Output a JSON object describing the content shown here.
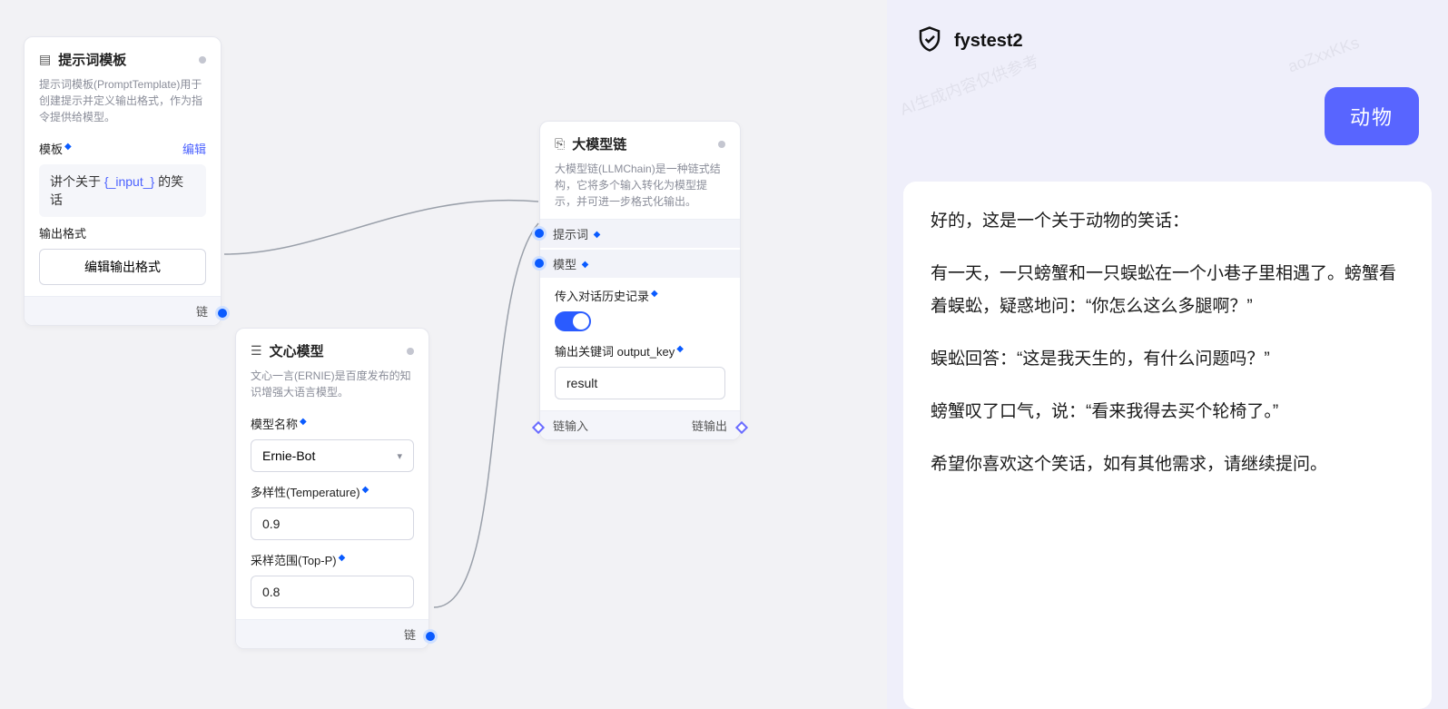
{
  "nodes": {
    "prompt": {
      "title": "提示词模板",
      "desc": "提示词模板(PromptTemplate)用于创建提示并定义输出格式，作为指令提供给模型。",
      "template_label": "模板",
      "edit_label": "编辑",
      "template_prefix": "讲个关于",
      "template_var": "{_input_}",
      "template_suffix": "的笑话",
      "output_format_label": "输出格式",
      "edit_output_format_btn": "编辑输出格式",
      "footer_label": "链"
    },
    "ernie": {
      "title": "文心模型",
      "desc": "文心一言(ERNIE)是百度发布的知识增强大语言模型。",
      "model_name_label": "模型名称",
      "model_name_value": "Ernie-Bot",
      "temperature_label": "多样性(Temperature)",
      "temperature_value": "0.9",
      "topp_label": "采样范围(Top-P)",
      "topp_value": "0.8",
      "footer_label": "链"
    },
    "chain": {
      "title": "大模型链",
      "desc": "大模型链(LLMChain)是一种链式结构，它将多个输入转化为模型提示，并可进一步格式化输出。",
      "prompt_row": "提示词",
      "model_row": "模型",
      "history_label": "传入对话历史记录",
      "output_key_label": "输出关键词 output_key",
      "output_key_value": "result",
      "footer_in": "链输入",
      "footer_out": "链输出"
    }
  },
  "chat": {
    "title": "fystest2",
    "user_message": "动物",
    "assistant_paragraphs": [
      "好的，这是一个关于动物的笑话：",
      "有一天，一只螃蟹和一只蜈蚣在一个小巷子里相遇了。螃蟹看着蜈蚣，疑惑地问：“你怎么这么多腿啊？”",
      "蜈蚣回答：“这是我天生的，有什么问题吗？”",
      "螃蟹叹了口气，说：“看来我得去买个轮椅了。”",
      "希望你喜欢这个笑话，如有其他需求，请继续提问。"
    ],
    "watermark_a": "AI生成内容仅供参考",
    "watermark_b": "aoZxxKKs"
  },
  "colors": {
    "accent": "#5865ff",
    "port": "#0a5bff"
  }
}
